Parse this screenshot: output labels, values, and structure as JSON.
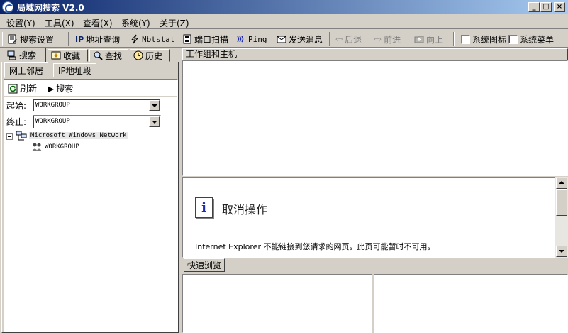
{
  "window": {
    "title": "局域网搜索 V2.0",
    "minimize_glyph": "_",
    "maximize_glyph": "□",
    "close_glyph": "×"
  },
  "menu": [
    "设置(Y)",
    "工具(X)",
    "查看(X)",
    "系统(Y)",
    "关于(Z)"
  ],
  "toolbar": {
    "search_settings": "搜索设置",
    "ip_lookup": "地址查询",
    "ip_prefix": "IP",
    "nbtstat": "Nbtstat",
    "port_scan": "端口扫描",
    "ping": "Ping",
    "send_message": "发送消息",
    "back": "后退",
    "forward": "前进",
    "up": "向上",
    "system_icon": "系统图标",
    "system_menu": "系统菜单"
  },
  "left_tabs": [
    "搜索",
    "收藏",
    "查找",
    "历史"
  ],
  "sub_tabs": [
    "网上邻居",
    "IP地址段"
  ],
  "actions": {
    "refresh": "刷新",
    "search": "搜索"
  },
  "range": {
    "start_label": "起始:",
    "start_value": "WORKGROUP",
    "end_label": "终止:",
    "end_value": "WORKGROUP"
  },
  "tree": {
    "root": "Microsoft Windows Network",
    "child": "WORKGROUP"
  },
  "right": {
    "header": "工作组和主机",
    "error_title": "取消操作",
    "error_message": "Internet Explorer 不能链接到您请求的网页。此页可能暂时不可用。",
    "quick_tab": "快速浏览"
  },
  "icons": {
    "info": "i",
    "play": "▶"
  },
  "colors": {
    "title_start": "#0a246a",
    "title_end": "#a6caf0",
    "face": "#d4d0c8",
    "info_blue": "#1c2bb0"
  }
}
